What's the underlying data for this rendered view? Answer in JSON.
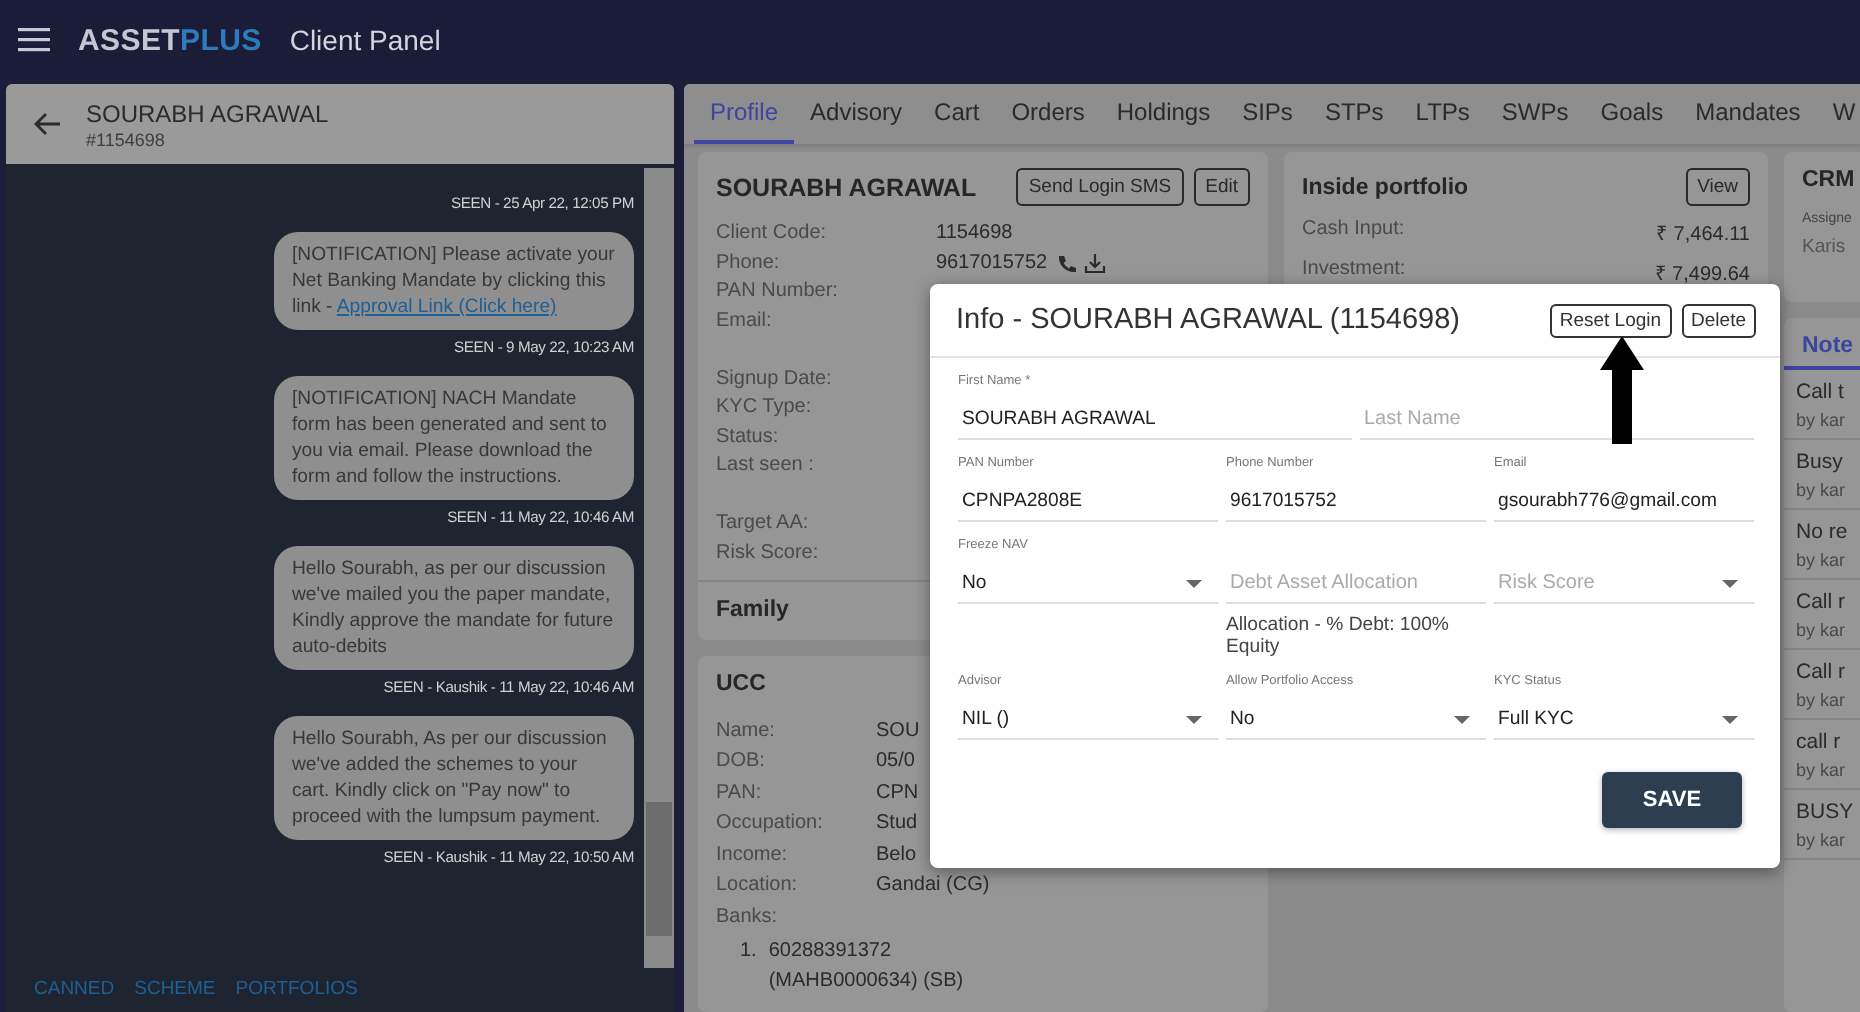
{
  "app_bar": {
    "brand_first": "ASSET",
    "brand_second": "PLUS",
    "title": "Client Panel"
  },
  "chat": {
    "name": "SOURABH AGRAWAL",
    "id": "#1154698",
    "messages": [
      {
        "meta": "SEEN - 25 Apr 22, 12:05 PM"
      },
      {
        "text": "[NOTIFICATION] Please activate your Net Banking Mandate by clicking this link - ",
        "link": "Approval Link (Click here)",
        "meta": "SEEN - 9 May 22, 10:23 AM"
      },
      {
        "text": "[NOTIFICATION] NACH Mandate form has been generated and sent to you via email. Please download the form and follow the instructions.",
        "meta": "SEEN - 11 May 22, 10:46 AM"
      },
      {
        "text": "Hello Sourabh, as per our discussion we've mailed you the paper mandate, Kindly approve the mandate for future auto-debits",
        "meta": "SEEN - Kaushik - 11 May 22, 10:46 AM"
      },
      {
        "text": "Hello Sourabh, As per our discussion we've added the schemes to your cart. Kindly click on \"Pay now\" to proceed with the lumpsum payment.",
        "meta": "SEEN - Kaushik - 11 May 22, 10:50 AM"
      }
    ],
    "actions": [
      "CANNED",
      "SCHEME",
      "PORTFOLIOS"
    ]
  },
  "tabs": [
    {
      "label": "Profile",
      "selected": true
    },
    {
      "label": "Advisory",
      "selected": false
    },
    {
      "label": "Cart",
      "selected": false
    },
    {
      "label": "Orders",
      "selected": false
    },
    {
      "label": "Holdings",
      "selected": false
    },
    {
      "label": "SIPs",
      "selected": false
    },
    {
      "label": "STPs",
      "selected": false
    },
    {
      "label": "LTPs",
      "selected": false
    },
    {
      "label": "SWPs",
      "selected": false
    },
    {
      "label": "Goals",
      "selected": false
    },
    {
      "label": "Mandates",
      "selected": false
    },
    {
      "label": "W",
      "selected": false
    }
  ],
  "profile": {
    "title": "SOURABH AGRAWAL",
    "buttons": [
      "Send Login SMS",
      "Edit"
    ],
    "rows": [
      {
        "label": "Client Code:",
        "value": "1154698",
        "kind": "text"
      },
      {
        "label": "Phone:",
        "value": "9617015752",
        "kind": "phone"
      },
      {
        "label": "PAN Number:",
        "kind": "text"
      },
      {
        "label": "Email:",
        "kind": "tall"
      },
      {
        "label": "Signup Date:",
        "kind": "text"
      },
      {
        "label": "KYC Type:",
        "kind": "text"
      },
      {
        "label": "Status:",
        "kind": "text"
      },
      {
        "label": "Last seen :",
        "kind": "tall"
      },
      {
        "label": "Target AA:",
        "kind": "text"
      },
      {
        "label": "Risk Score:",
        "kind": "text"
      }
    ],
    "family": "Family"
  },
  "ucc": {
    "title": "UCC",
    "rows": [
      {
        "label": "Name:",
        "value": "SOU"
      },
      {
        "label": "DOB:",
        "value": "05/0"
      },
      {
        "label": "PAN:",
        "value": "CPN"
      },
      {
        "label": "Occupation:",
        "value": "Stud"
      },
      {
        "label": "Income:",
        "value": "Belo"
      },
      {
        "label": "Location:",
        "value": "Gandai (CG)"
      }
    ],
    "banks": {
      "label": "Banks:",
      "items": [
        {
          "number": "1.",
          "lines": [
            "60288391372",
            "(MAHB0000634) (SB)"
          ]
        }
      ]
    }
  },
  "portfolio": {
    "title": "Inside portfolio",
    "button": "View",
    "rows": [
      {
        "label": "Cash Input:",
        "value": "₹ 7,464.11"
      },
      {
        "label": "Investment:",
        "value": "₹ 7,499.64"
      }
    ]
  },
  "crm": {
    "title": "CRM",
    "assignee_label": "Assigne",
    "assignee": "Karis",
    "notes_tab": "Note",
    "notes": [
      {
        "text": "Call t",
        "by": "by kar"
      },
      {
        "text": "Busy",
        "by": "by kar"
      },
      {
        "text": "No re",
        "by": "by kar"
      },
      {
        "text": "Call r",
        "by": "by kar"
      },
      {
        "text": "Call r",
        "by": "by kar"
      },
      {
        "text": "call r",
        "by": "by kar"
      },
      {
        "text": "BUSY",
        "by": "by kar"
      }
    ]
  },
  "modal": {
    "title": "Info - SOURABH AGRAWAL (1154698)",
    "buttons": [
      "Reset Login",
      "Delete"
    ],
    "rows": [
      [
        {
          "label": "First Name *",
          "value": "SOURABH AGRAWAL",
          "kind": "text"
        },
        {
          "placeholder": "Last Name",
          "kind": "text"
        }
      ],
      [
        {
          "label": "PAN Number",
          "value": "CPNPA2808E",
          "kind": "text"
        },
        {
          "label": "Phone Number",
          "value": "9617015752",
          "kind": "text"
        },
        {
          "label": "Email",
          "value": "gsourabh776@gmail.com",
          "kind": "text"
        }
      ],
      [
        {
          "label": "Freeze NAV",
          "value": "No",
          "kind": "select"
        },
        {
          "placeholder": "Debt Asset Allocation",
          "kind": "text",
          "helper": "Allocation - % Debt: 100% Equity"
        },
        {
          "placeholder": "Risk Score",
          "kind": "select"
        }
      ],
      [
        {
          "label": "Advisor",
          "value": "NIL ()",
          "kind": "select"
        },
        {
          "label": "Allow Portfolio Access",
          "value": "No",
          "kind": "select"
        },
        {
          "label": "KYC Status",
          "value": "Full KYC",
          "kind": "select"
        }
      ]
    ],
    "save": "SAVE"
  }
}
